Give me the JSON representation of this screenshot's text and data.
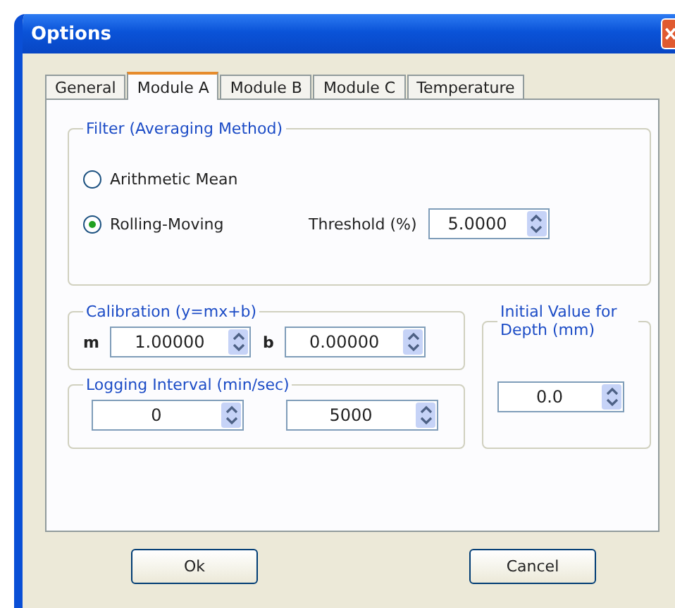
{
  "window": {
    "title": "Options"
  },
  "tabs": [
    {
      "label": "General",
      "selected": false
    },
    {
      "label": "Module A",
      "selected": true
    },
    {
      "label": "Module B",
      "selected": false
    },
    {
      "label": "Module C",
      "selected": false
    },
    {
      "label": "Temperature",
      "selected": false
    }
  ],
  "filter_group": {
    "title": "Filter (Averaging Method)",
    "options": [
      {
        "label": "Arithmetic Mean",
        "selected": false
      },
      {
        "label": "Rolling-Moving",
        "selected": true
      }
    ],
    "threshold": {
      "label": "Threshold (%)",
      "value": "5.0000"
    }
  },
  "calibration_group": {
    "title": "Calibration (y=mx+b)",
    "fields": [
      {
        "label": "m",
        "value": "1.00000"
      },
      {
        "label": "b",
        "value": "0.00000"
      }
    ]
  },
  "initial_value_group": {
    "title": "Initial Value for Depth (mm)",
    "value": "0.0"
  },
  "logging_group": {
    "title": "Logging Interval (min/sec)",
    "fields": [
      {
        "value": "0"
      },
      {
        "value": "5000"
      }
    ]
  },
  "buttons": [
    "Ok",
    "Cancel"
  ]
}
